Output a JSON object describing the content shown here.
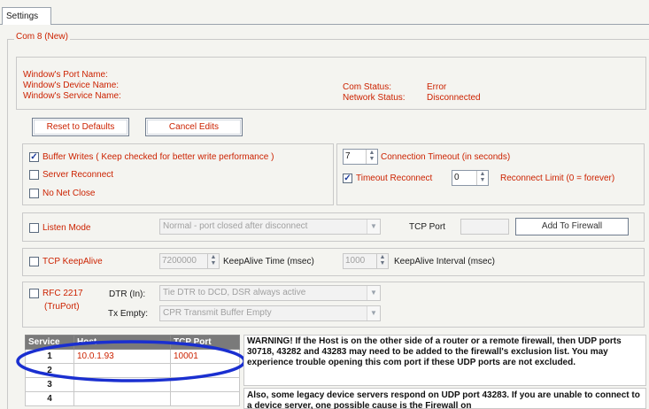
{
  "tab": {
    "label": "Settings"
  },
  "group_title": "Com 8 (New)",
  "info": {
    "port_name_label": "Window's Port Name:",
    "device_name_label": "Window's Device Name:",
    "service_name_label": "Window's Service Name:",
    "com_status_label": "Com Status:",
    "com_status_value": "Error",
    "network_status_label": "Network Status:",
    "network_status_value": "Disconnected"
  },
  "buttons": {
    "reset": "Reset to Defaults",
    "cancel": "Cancel Edits",
    "firewall": "Add To Firewall"
  },
  "options": {
    "buffer_writes": "Buffer Writes   ( Keep checked for better write performance )",
    "server_reconnect": "Server Reconnect",
    "no_net_close": "No Net Close",
    "connection_timeout_value": "7",
    "connection_timeout_label": "Connection Timeout (in seconds)",
    "timeout_reconnect": "Timeout Reconnect",
    "reconnect_limit_value": "0",
    "reconnect_limit_label": "Reconnect Limit (0 = forever)"
  },
  "listen": {
    "label": "Listen Mode",
    "mode_value": "Normal - port closed after disconnect",
    "tcp_port_label": "TCP Port"
  },
  "keepalive": {
    "label": "TCP KeepAlive",
    "time_value": "7200000",
    "time_label": "KeepAlive Time (msec)",
    "interval_value": "1000",
    "interval_label": "KeepAlive Interval (msec)"
  },
  "rfc": {
    "label_line1": "RFC 2217",
    "label_line2": "(TruPort)",
    "dtr_label": "DTR (In):",
    "dtr_value": "Tie DTR to DCD, DSR always active",
    "tx_label": "Tx Empty:",
    "tx_value": "CPR Transmit Buffer Empty"
  },
  "table": {
    "headers": [
      "Service",
      "Host",
      "TCP Port"
    ],
    "rows": [
      {
        "service": "1",
        "host": "10.0.1.93",
        "port": "10001"
      },
      {
        "service": "2",
        "host": "",
        "port": ""
      },
      {
        "service": "3",
        "host": "",
        "port": ""
      },
      {
        "service": "4",
        "host": "",
        "port": ""
      }
    ]
  },
  "warning": {
    "text1": "WARNING!  If the Host is on the other side of a router or a remote firewall, then UDP ports 30718, 43282 and 43283 may need to be added to the firewall's exclusion list.  You may experience trouble opening this com port if these UDP ports are not excluded.",
    "text2": "Also, some legacy device servers respond on UDP port 43283.  If you are unable to connect to a device server, one possible cause is the Firewall on"
  },
  "colors": {
    "accent_red": "#cc2200",
    "highlight_ellipse": "#1a2fd0"
  }
}
